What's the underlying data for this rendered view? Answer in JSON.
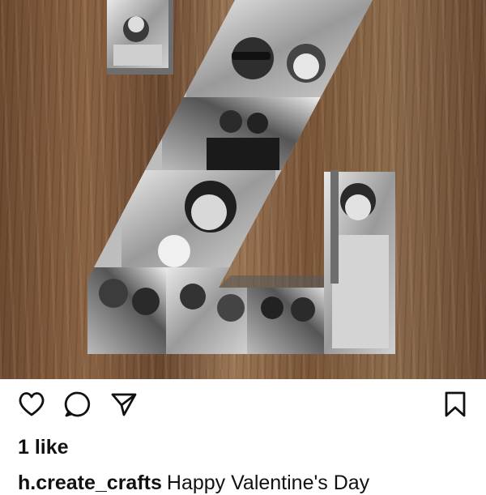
{
  "post": {
    "image_alt": "Letter Z photo collage on wooden background",
    "likes_label": "1 like",
    "username": "h.create_crafts",
    "caption_text": "Happy Valentine's Day"
  },
  "actions": {
    "like_icon": "heart-icon",
    "comment_icon": "comment-icon",
    "share_icon": "send-icon",
    "save_icon": "bookmark-icon"
  },
  "colors": {
    "text": "#111111",
    "background": "#ffffff",
    "wood": "#7a5538"
  }
}
